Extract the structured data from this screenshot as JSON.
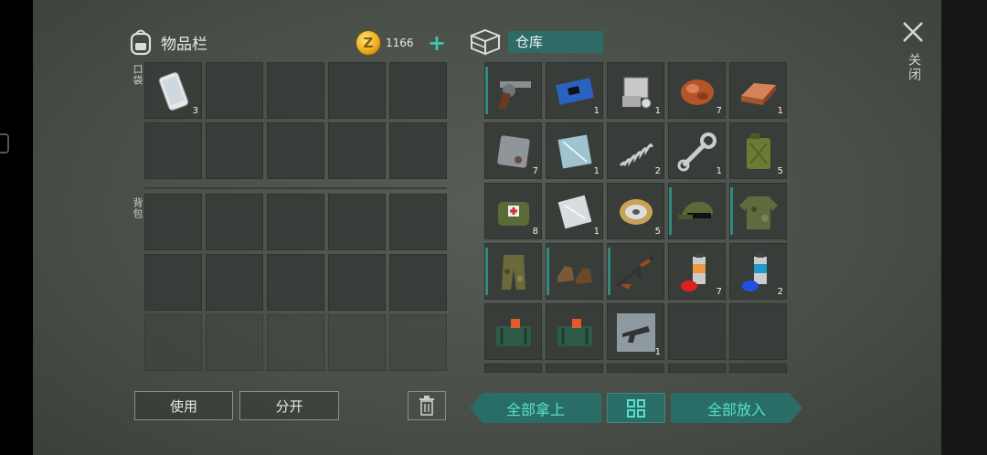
{
  "inventory": {
    "title": "物品栏",
    "icon": "backpack-icon",
    "coins": "1166",
    "coin_symbol": "Z",
    "add_icon": "plus-icon",
    "pockets_label": "口袋",
    "backpack_label": "背包",
    "pocket_slots": [
      {
        "item": "smartphone",
        "count": "3"
      },
      {
        "item": "",
        "count": ""
      },
      {
        "item": "",
        "count": ""
      },
      {
        "item": "",
        "count": ""
      },
      {
        "item": "",
        "count": ""
      },
      {
        "item": "",
        "count": ""
      },
      {
        "item": "",
        "count": ""
      },
      {
        "item": "",
        "count": ""
      },
      {
        "item": "",
        "count": ""
      },
      {
        "item": "",
        "count": ""
      }
    ],
    "backpack_rows": 3,
    "use_button": "使用",
    "split_button": "分开",
    "trash_icon": "trash-icon"
  },
  "storage": {
    "title": "仓库",
    "icon": "storage-crate-icon",
    "items": [
      {
        "item": "revolver",
        "count": ""
      },
      {
        "item": "circuit-board",
        "count": "1"
      },
      {
        "item": "engine-part",
        "count": "1"
      },
      {
        "item": "raw-meat",
        "count": "7"
      },
      {
        "item": "copper-ingot",
        "count": "1"
      },
      {
        "item": "iron-plate",
        "count": "7"
      },
      {
        "item": "steel-plate",
        "count": "1"
      },
      {
        "item": "spring",
        "count": "2"
      },
      {
        "item": "wrench",
        "count": "1"
      },
      {
        "item": "jerrycan",
        "count": "5"
      },
      {
        "item": "medkit-bag",
        "count": "8"
      },
      {
        "item": "aluminum-plate",
        "count": "1"
      },
      {
        "item": "wire-spool",
        "count": "5"
      },
      {
        "item": "camo-cap",
        "count": ""
      },
      {
        "item": "camo-jacket",
        "count": ""
      },
      {
        "item": "camo-pants",
        "count": ""
      },
      {
        "item": "boots",
        "count": ""
      },
      {
        "item": "ak-rifle",
        "count": ""
      },
      {
        "item": "spray-can-red",
        "count": "7"
      },
      {
        "item": "spray-can-blue",
        "count": "2"
      },
      {
        "item": "explosive-box",
        "count": ""
      },
      {
        "item": "explosive-box",
        "count": ""
      },
      {
        "item": "smg-blueprint",
        "count": "1"
      },
      {
        "item": "",
        "count": ""
      },
      {
        "item": "",
        "count": ""
      }
    ],
    "take_all": "全部拿上",
    "put_all": "全部放入",
    "sort_icon": "grid-sort-icon"
  },
  "close": {
    "label": "关闭",
    "icon": "close-icon"
  },
  "colors": {
    "accent": "#2a6c66",
    "accent_text": "#58e0cd",
    "slot": "#393d39",
    "background": "#4a4f49"
  }
}
